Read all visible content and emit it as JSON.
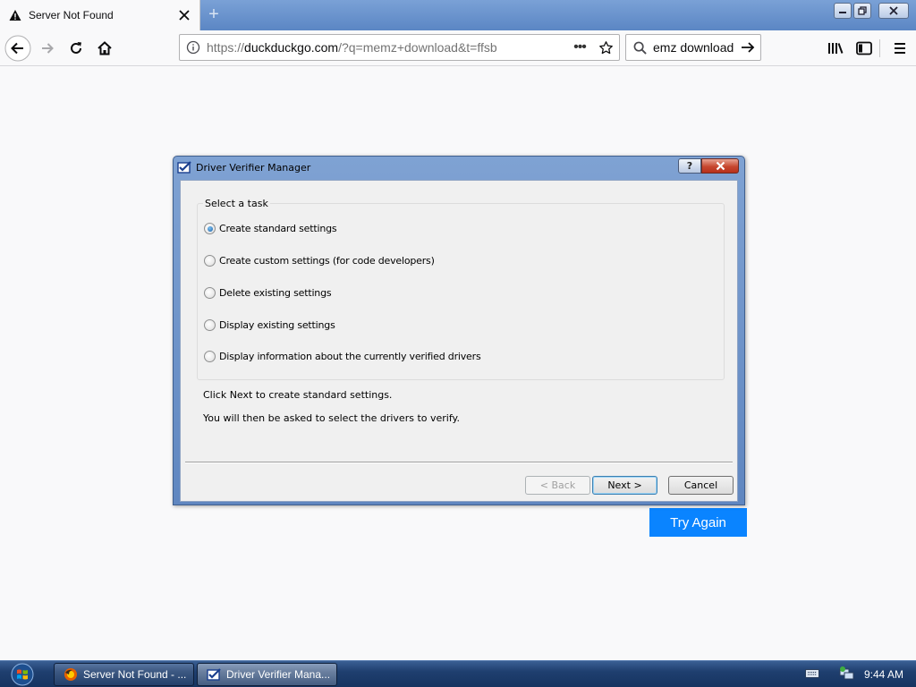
{
  "browser": {
    "tab_title": "Server Not Found",
    "url_domain": "duckduckgo.com",
    "url_prefix": "https://",
    "url_path": "/?q=memz+download&t=ffsb",
    "search_text": "еmz download"
  },
  "page": {
    "try_again_label": "Try Again"
  },
  "dialog": {
    "title": "Driver Verifier Manager",
    "help_label": "?",
    "group_label": "Select a task",
    "options": [
      {
        "label": "Create standard settings",
        "selected": true
      },
      {
        "label": "Create custom settings (for code developers)",
        "selected": false
      },
      {
        "label": "Delete existing settings",
        "selected": false
      },
      {
        "label": "Display existing settings",
        "selected": false
      },
      {
        "label": "Display information about the currently verified drivers",
        "selected": false
      }
    ],
    "hint_1": "Click Next to create standard settings.",
    "hint_2": "You will then be asked to select the drivers to verify.",
    "back_label": "< Back",
    "next_label": "Next >",
    "cancel_label": "Cancel"
  },
  "taskbar": {
    "tasks": [
      {
        "label": "Server Not Found - ...",
        "active": false
      },
      {
        "label": "Driver Verifier Mana...",
        "active": true
      }
    ],
    "clock": "9:44 AM"
  },
  "colors": {
    "accent": "#0a84ff",
    "titlebar": "#6f95cc"
  }
}
